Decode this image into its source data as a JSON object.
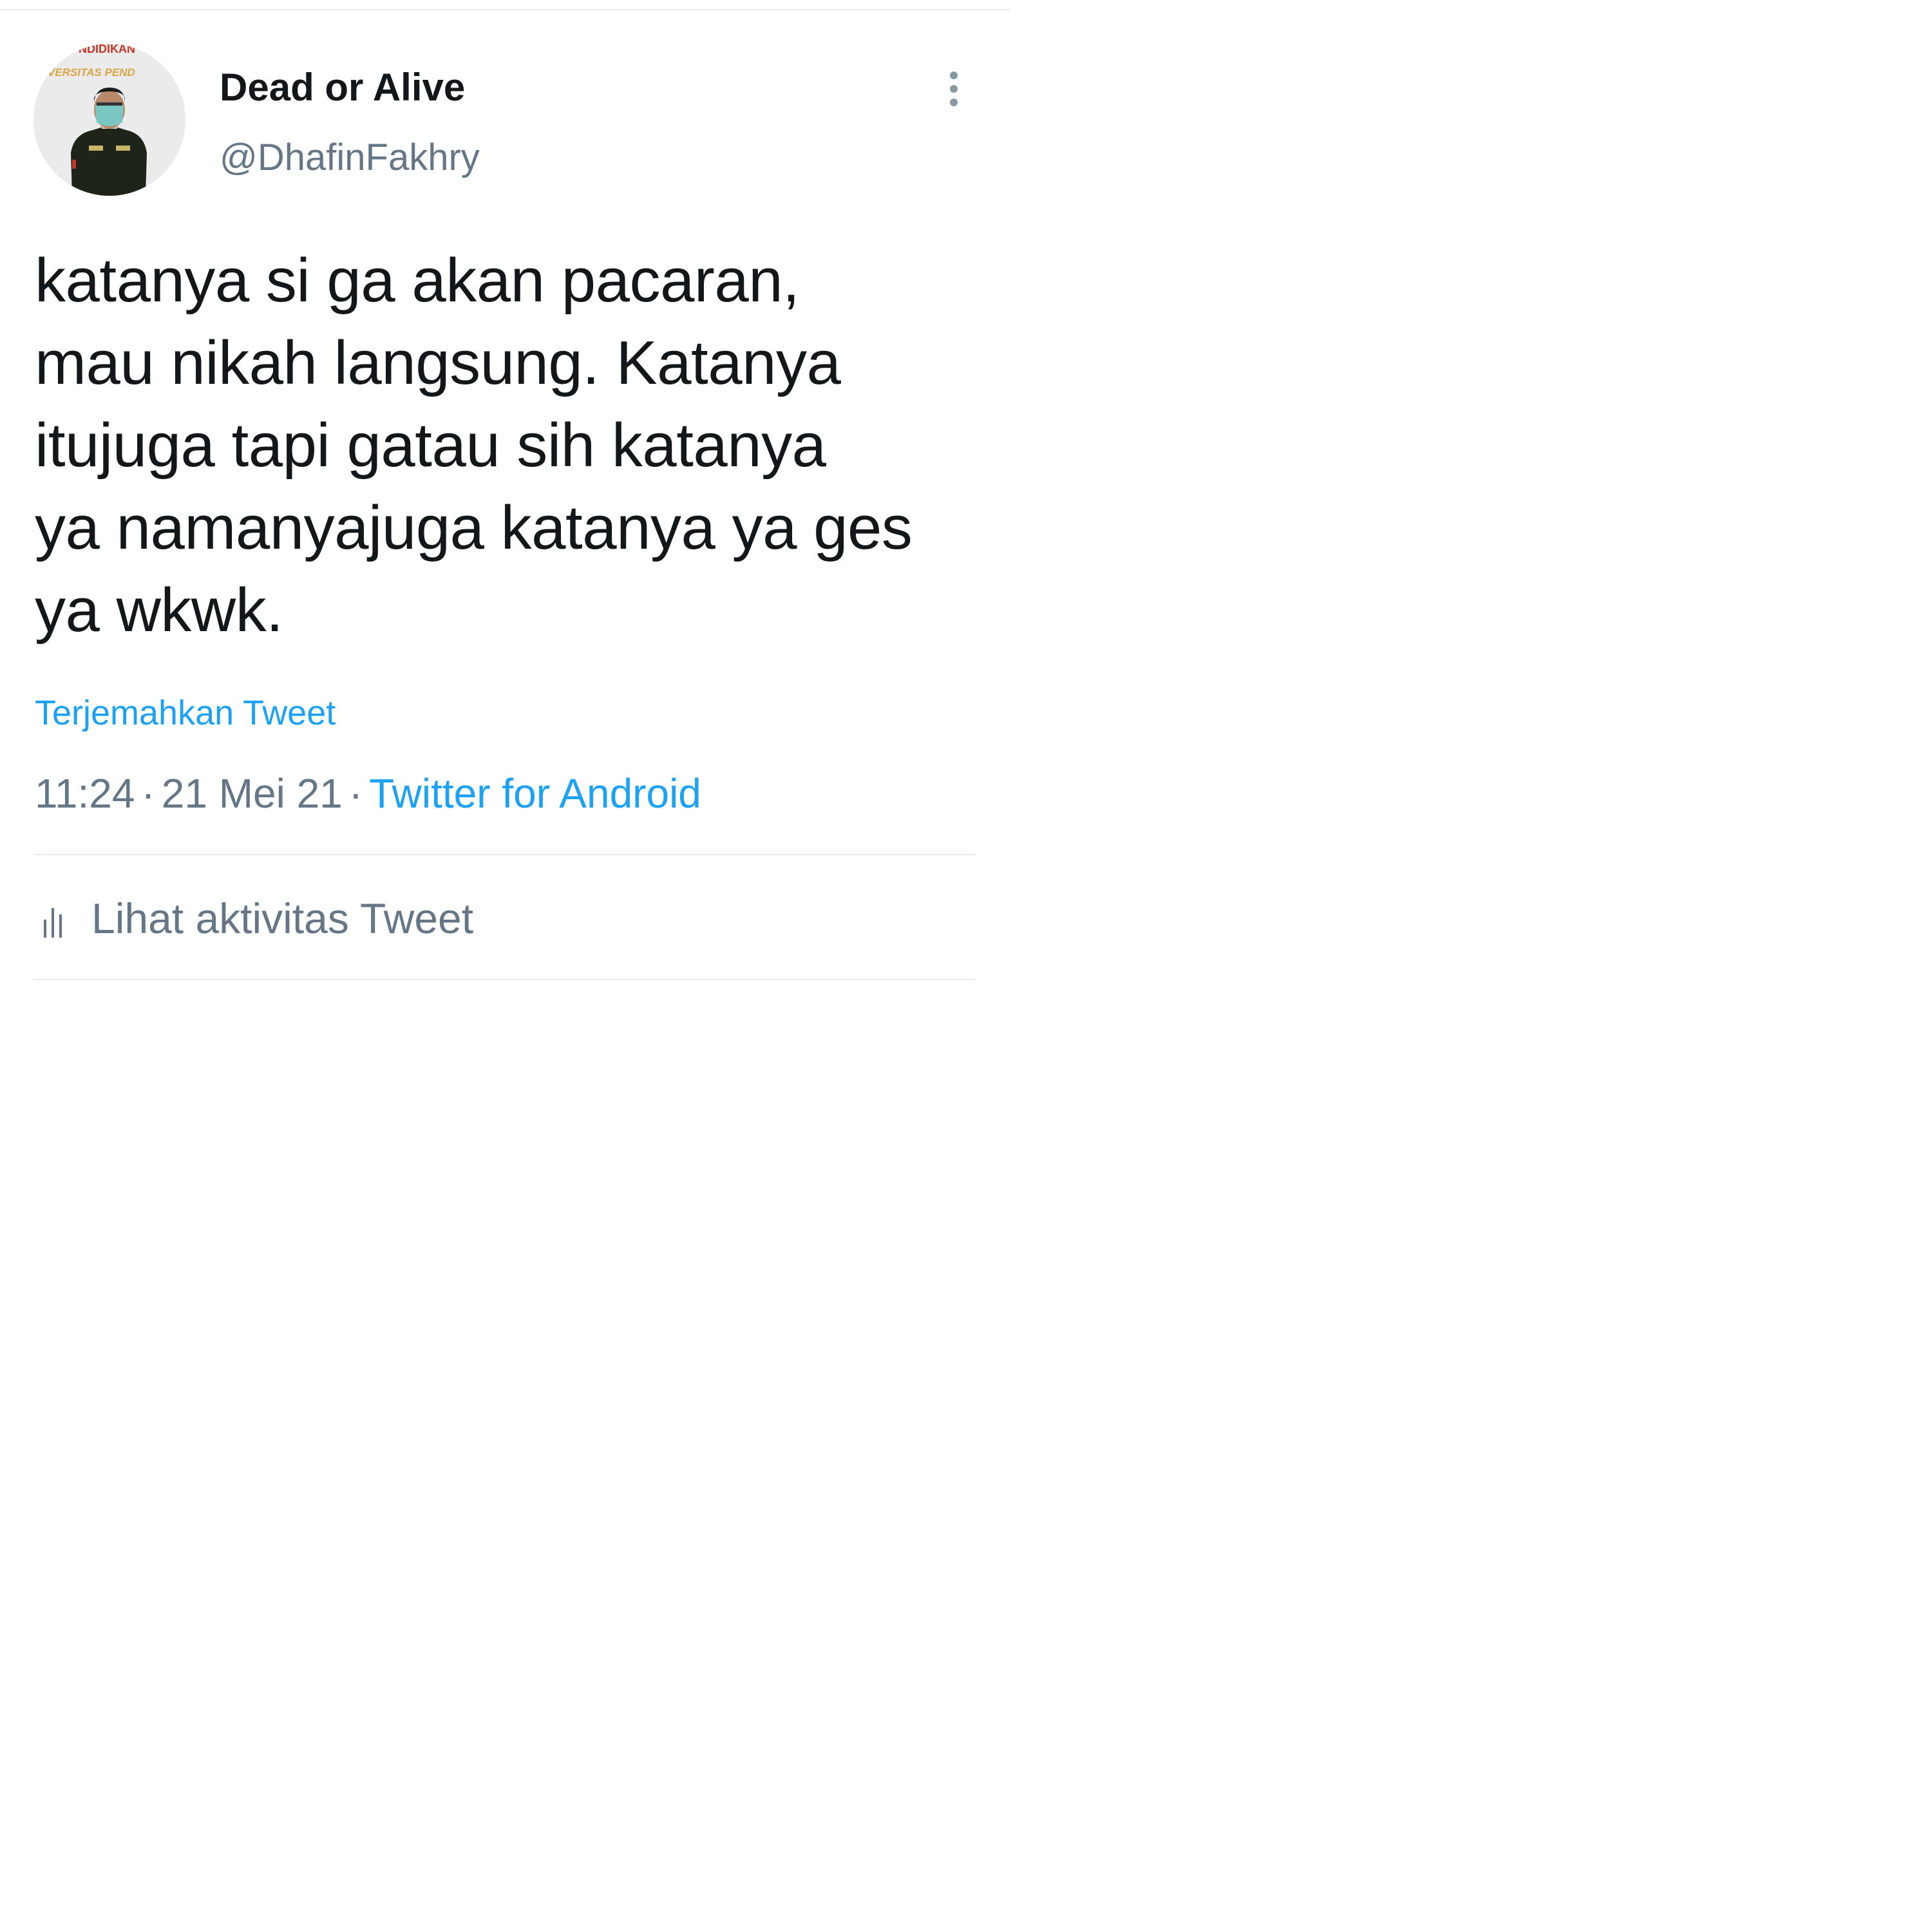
{
  "tweet": {
    "author": {
      "display_name": "Dead or Alive",
      "handle": "@DhafinFakhry",
      "avatar_banner_text_1": "NDIDIKAN",
      "avatar_banner_text_2": "VERSITAS PEND"
    },
    "text_lines": [
      "katanya si ga akan pacaran,",
      "mau nikah langsung. Katanya",
      "itujuga tapi gatau sih katanya",
      "ya namanyajuga katanya ya ges",
      "ya wkwk."
    ],
    "translate_label": "Terjemahkan Tweet",
    "time": "11:24",
    "date": "21 Mei 21",
    "separator": "·",
    "source": "Twitter for Android",
    "activity_label": "Lihat aktivitas Tweet",
    "more_icon": "more-vertical-icon",
    "activity_icon": "bar-chart-icon"
  },
  "colors": {
    "text_primary": "#14171a",
    "text_secondary": "#657786",
    "link": "#1da1f2",
    "divider": "#e6ecf0"
  }
}
